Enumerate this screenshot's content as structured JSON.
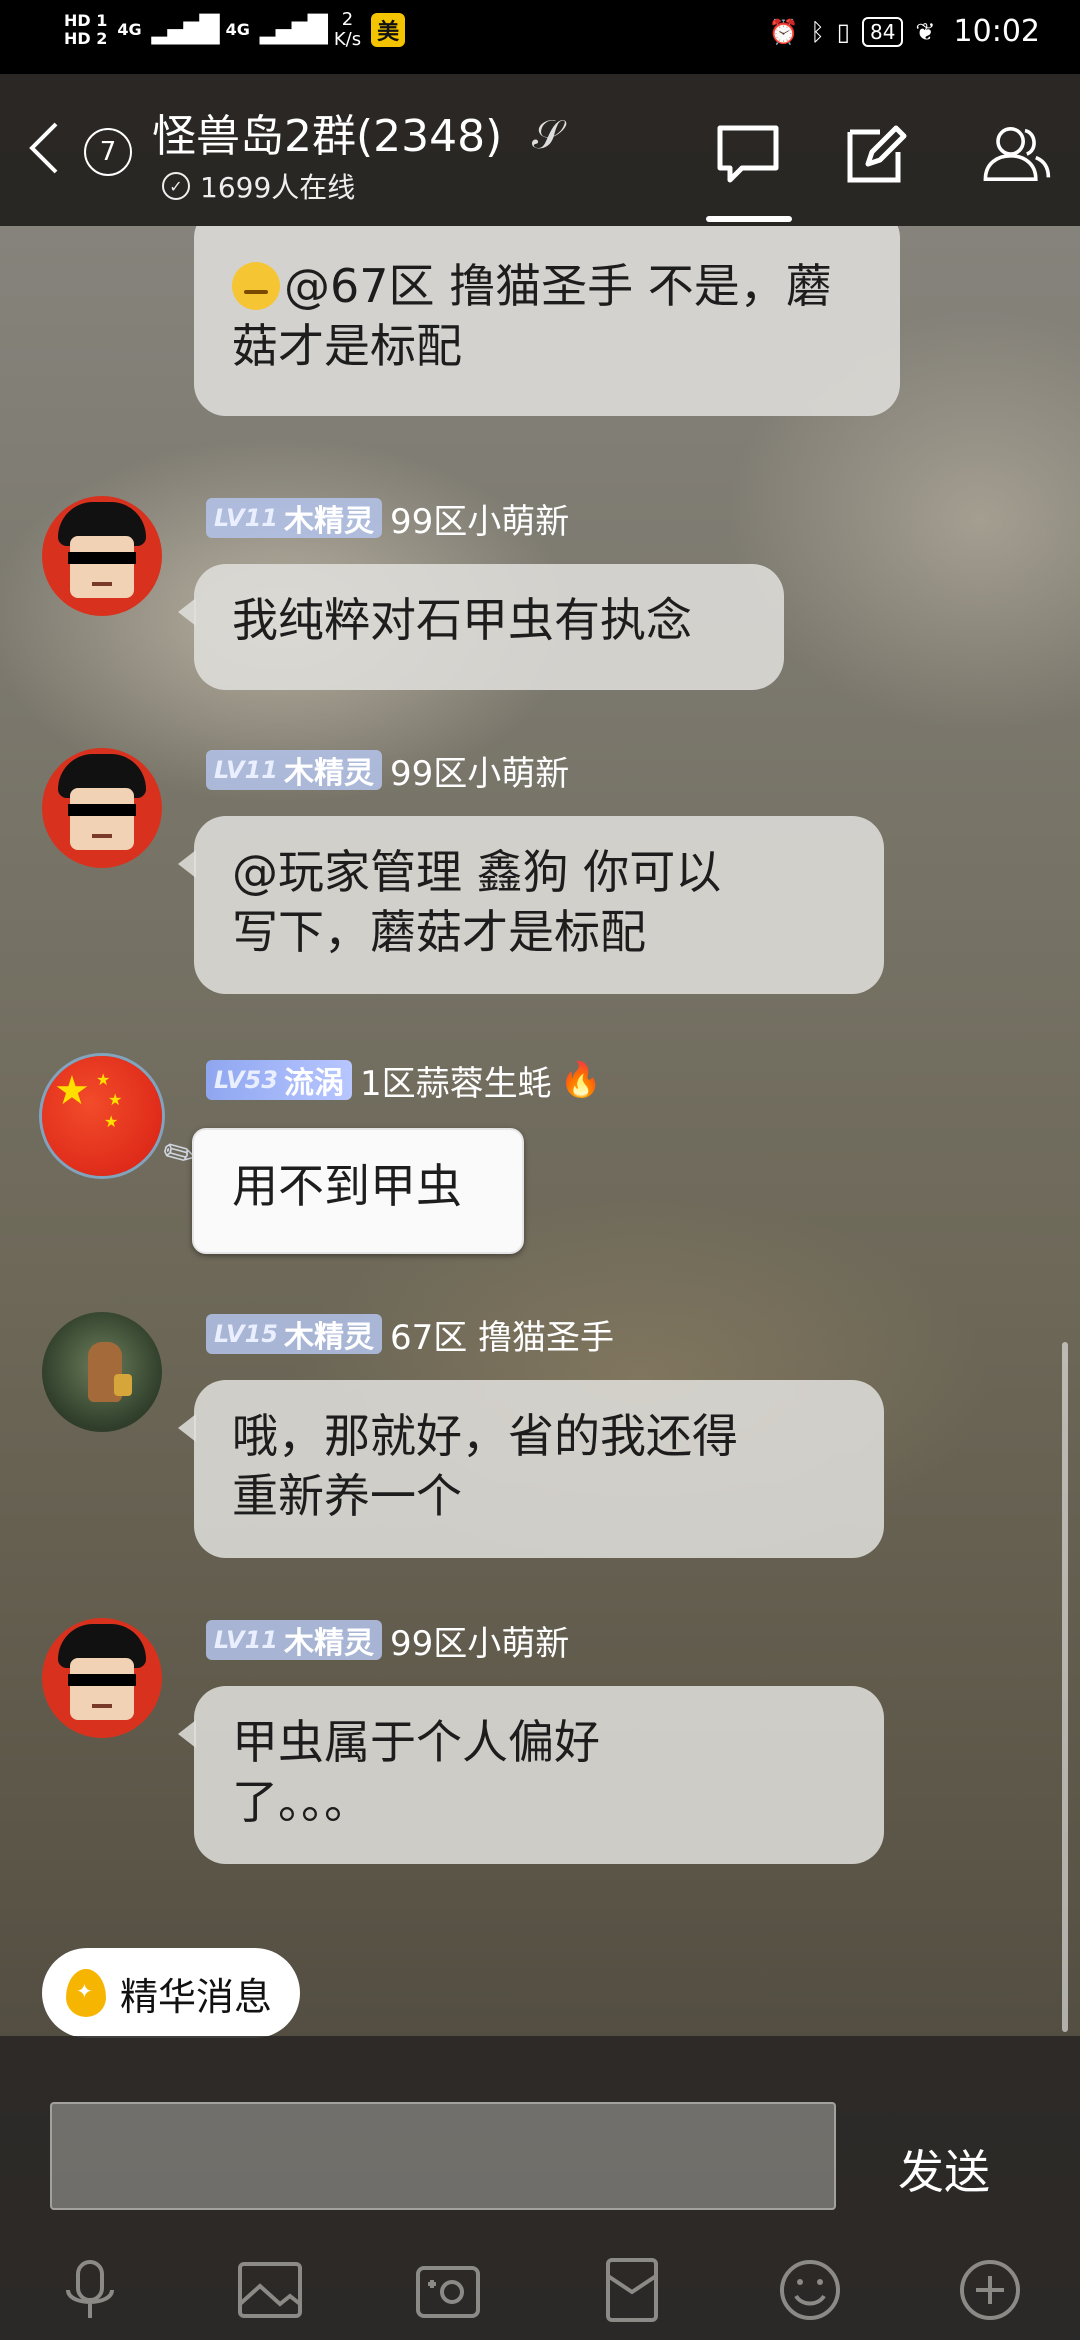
{
  "status_bar": {
    "hd1": "HD 1",
    "hd2": "HD 2",
    "net1": "4G",
    "net2": "4G",
    "speed_value": "2",
    "speed_unit": "K/s",
    "carrier_badge": "美",
    "battery": "84",
    "time": "10:02"
  },
  "header": {
    "unread_count": "7",
    "title": "怪兽岛2群(2348)",
    "online": "1699人在线"
  },
  "messages": [
    {
      "text": "@67区 撸猫圣手 不是，蘑菇才是标配"
    },
    {
      "level": "LV11",
      "title": "木精灵",
      "name": "99区小萌新",
      "text": "我纯粹对石甲虫有执念"
    },
    {
      "level": "LV11",
      "title": "木精灵",
      "name": "99区小萌新",
      "text_line1": "@玩家管理   鑫狗 你可以",
      "text_line2": "写下，蘑菇才是标配"
    },
    {
      "level": "LV53",
      "title": "流涡",
      "name": "1区蒜蓉生蚝",
      "text": "用不到甲虫"
    },
    {
      "level": "LV15",
      "title": "木精灵",
      "name": "67区 撸猫圣手",
      "text_line1": "哦，那就好，省的我还得",
      "text_line2": "重新养一个"
    },
    {
      "level": "LV11",
      "title": "木精灵",
      "name": "99区小萌新",
      "text_line1": "甲虫属于个人偏好",
      "text_line2": "了。。。"
    }
  ],
  "essence_button": "精华消息",
  "input": {
    "value": "",
    "send_label": "发送"
  },
  "icons": {
    "back": "chevron-left-icon",
    "ear": "ear-icon",
    "chat": "chat-bubble-icon",
    "edit": "edit-icon",
    "members": "group-members-icon",
    "voice": "microphone-icon",
    "image": "image-icon",
    "camera": "camera-icon",
    "red_packet": "red-packet-icon",
    "emoji": "emoji-icon",
    "more": "plus-icon"
  }
}
